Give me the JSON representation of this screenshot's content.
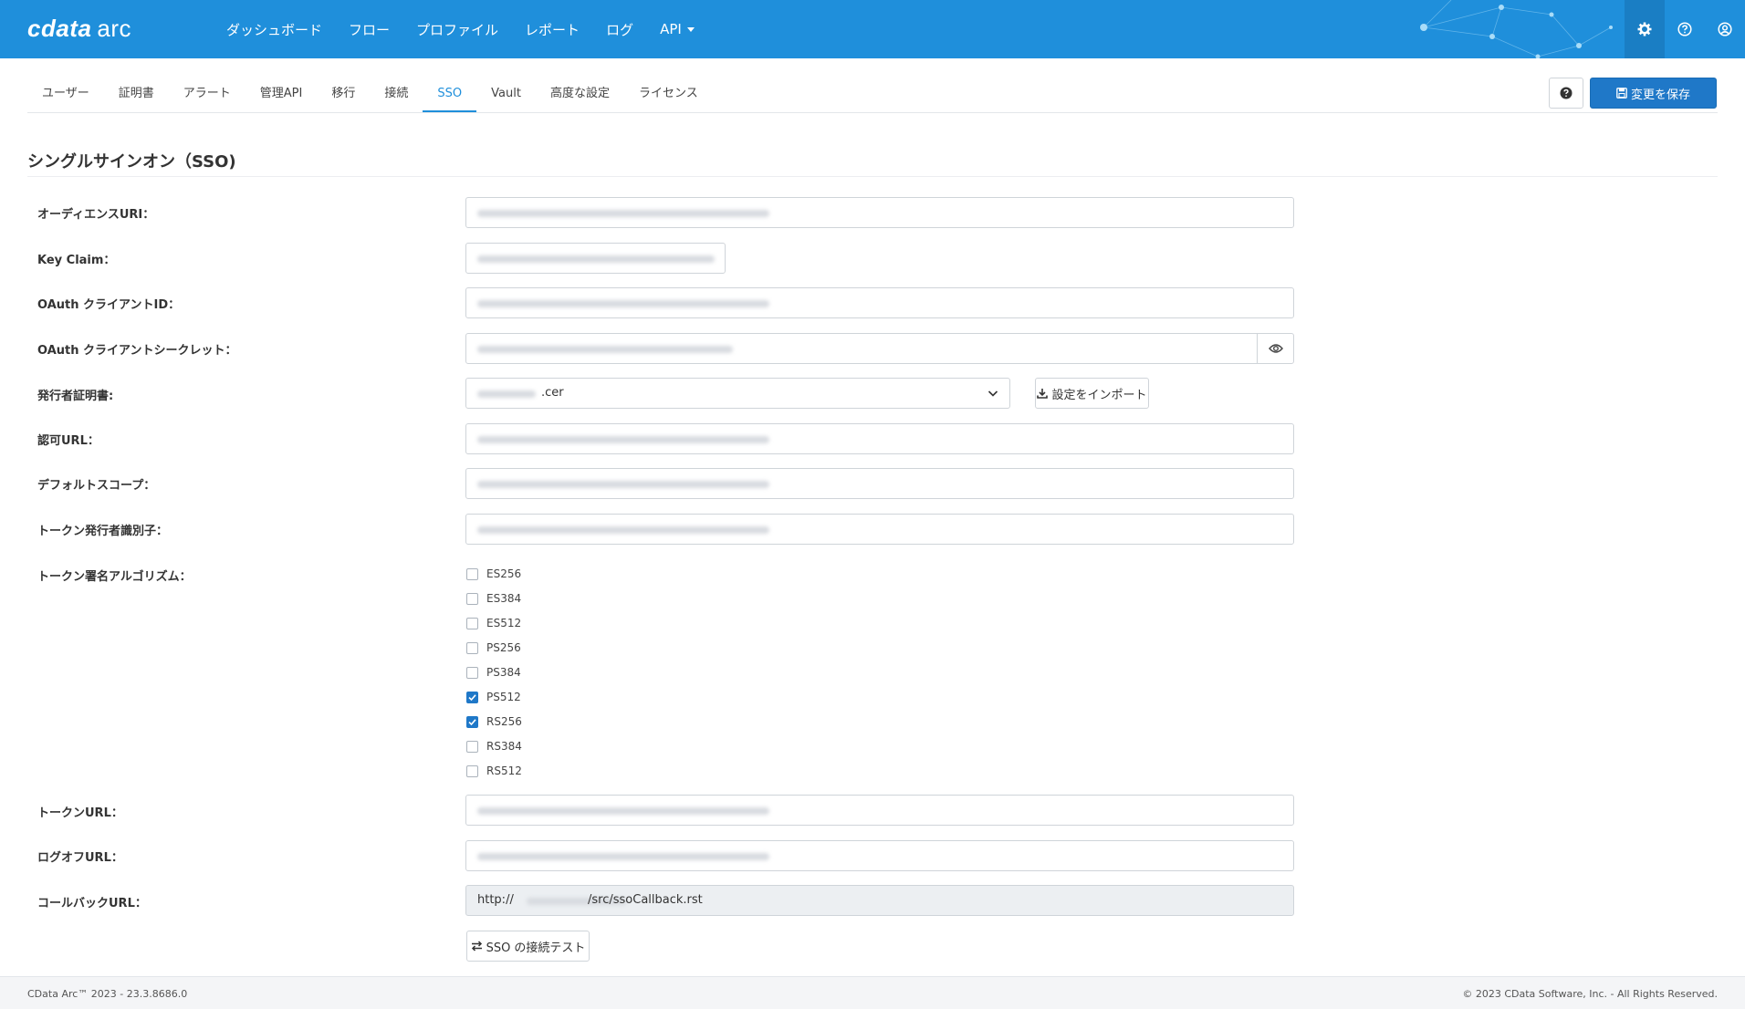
{
  "header": {
    "logo_brand": "cdata",
    "logo_product": "arc",
    "nav": [
      "ダッシュボード",
      "フロー",
      "プロファイル",
      "レポート",
      "ログ",
      "API"
    ],
    "colors": {
      "bar": "#1f8fdb",
      "active_icon_bg": "#1a7ec4"
    },
    "icons": [
      "gear-icon",
      "help-circle-icon",
      "user-circle-icon"
    ]
  },
  "subnav": {
    "tabs": [
      "ユーザー",
      "証明書",
      "アラート",
      "管理API",
      "移行",
      "接続",
      "SSO",
      "Vault",
      "高度な設定",
      "ライセンス"
    ],
    "active": "SSO",
    "save_label": "変更を保存"
  },
  "page": {
    "title": "シングルサインオン（SSO)"
  },
  "form": {
    "audience_uri_label": "オーディエンスURI：",
    "key_claim_label": "Key Claim：",
    "client_id_label": "OAuth クライアントID：",
    "client_secret_label": "OAuth クライアントシークレット：",
    "issuer_cert_label": "発行者証明書:",
    "issuer_cert_suffix": ".cer",
    "import_label": "設定をインポート",
    "auth_url_label": "認可URL：",
    "default_scope_label": "デフォルトスコープ：",
    "token_issuer_label": "トークン発行者識別子：",
    "algorithm_label": "トークン署名アルゴリズム：",
    "algorithms": [
      {
        "name": "ES256",
        "checked": false
      },
      {
        "name": "ES384",
        "checked": false
      },
      {
        "name": "ES512",
        "checked": false
      },
      {
        "name": "PS256",
        "checked": false
      },
      {
        "name": "PS384",
        "checked": false
      },
      {
        "name": "PS512",
        "checked": true
      },
      {
        "name": "RS256",
        "checked": true
      },
      {
        "name": "RS384",
        "checked": false
      },
      {
        "name": "RS512",
        "checked": false
      }
    ],
    "token_url_label": "トークンURL：",
    "logoff_url_label": "ログオフURL：",
    "callback_url_label": "コールバックURL：",
    "callback_prefix": "http://",
    "callback_suffix": "/src/ssoCallback.rst",
    "test_label": "SSO の接続テスト"
  },
  "footer": {
    "version": "CData Arc™ 2023 - 23.3.8686.0",
    "copyright": "© 2023 CData Software, Inc. - All Rights Reserved."
  }
}
